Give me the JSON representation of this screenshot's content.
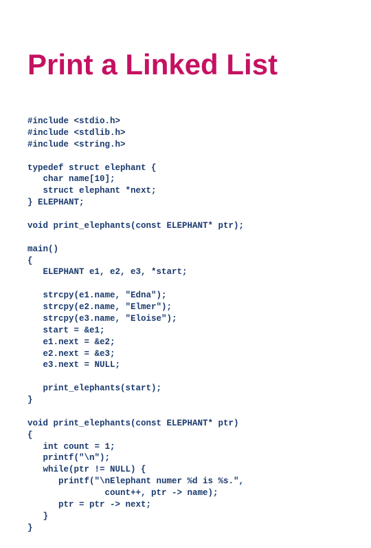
{
  "title": "Print a Linked List",
  "code": "#include <stdio.h>\n#include <stdlib.h>\n#include <string.h>\n\ntypedef struct elephant {\n   char name[10];\n   struct elephant *next;\n} ELEPHANT;\n\nvoid print_elephants(const ELEPHANT* ptr);\n\nmain()\n{\n   ELEPHANT e1, e2, e3, *start;\n\n   strcpy(e1.name, \"Edna\");\n   strcpy(e2.name, \"Elmer\");\n   strcpy(e3.name, \"Eloise\");\n   start = &e1;\n   e1.next = &e2;\n   e2.next = &e3;\n   e3.next = NULL;\n\n   print_elephants(start);\n}\n\nvoid print_elephants(const ELEPHANT* ptr)\n{\n   int count = 1;\n   printf(\"\\n\");\n   while(ptr != NULL) {\n      printf(\"\\nElephant numer %d is %s.\",\n               count++, ptr -> name);\n      ptr = ptr -> next;\n   }\n}"
}
